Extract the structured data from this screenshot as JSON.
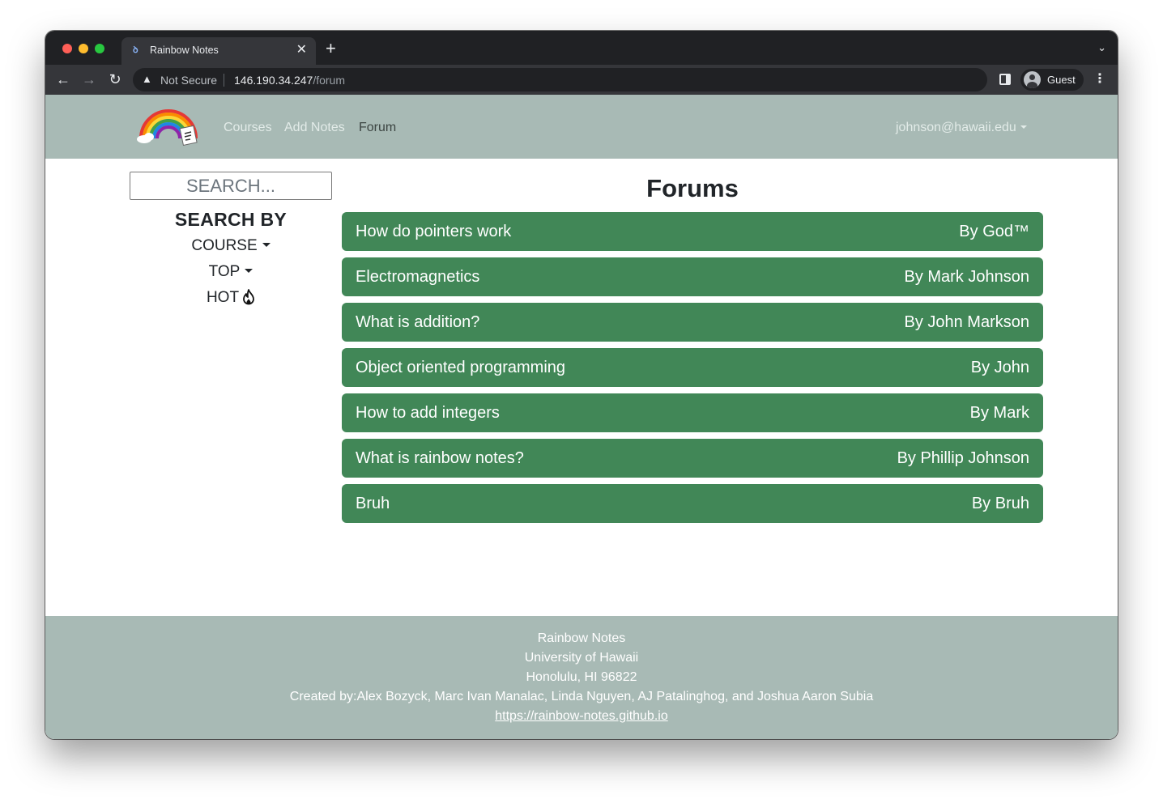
{
  "browser": {
    "tab_title": "Rainbow Notes",
    "tab_close": "✕",
    "new_tab": "+",
    "security_label": "Not Secure",
    "url_host": "146.190.34.247",
    "url_path": "/forum",
    "profile_label": "Guest"
  },
  "navbar": {
    "links": [
      "Courses",
      "Add Notes",
      "Forum"
    ],
    "active_link": "Forum",
    "user_email": "johnson@hawaii.edu"
  },
  "sidebar": {
    "search_placeholder": "SEARCH...",
    "heading": "SEARCH BY",
    "course_label": "COURSE",
    "top_label": "TOP",
    "hot_label": "HOT"
  },
  "main": {
    "title": "Forums",
    "forums": [
      {
        "title": "How do pointers work",
        "author": "By God™"
      },
      {
        "title": "Electromagnetics",
        "author": "By Mark Johnson"
      },
      {
        "title": "What is addition?",
        "author": "By John Markson"
      },
      {
        "title": "Object oriented programming",
        "author": "By John"
      },
      {
        "title": "How to add integers",
        "author": "By Mark"
      },
      {
        "title": "What is rainbow notes?",
        "author": "By Phillip Johnson"
      },
      {
        "title": "Bruh",
        "author": "By Bruh"
      }
    ]
  },
  "footer": {
    "line1": "Rainbow Notes",
    "line2": "University of Hawaii",
    "line3": "Honolulu, HI 96822",
    "credits": "Created by:Alex Bozyck, Marc Ivan Manalac, Linda Nguyen, AJ Patalinghog, and Joshua Aaron Subia",
    "link": "https://rainbow-notes.github.io"
  },
  "colors": {
    "navbar_bg": "#a8bab5",
    "forum_row_bg": "#418757",
    "footer_bg": "#a8bab5"
  }
}
